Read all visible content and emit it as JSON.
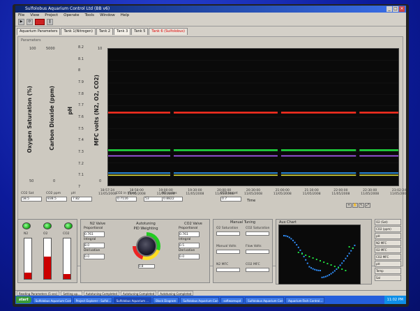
{
  "window": {
    "title": "Sulfolobus Aquarium Control Ltd (BB v6)"
  },
  "menu": [
    "File",
    "View",
    "Project",
    "Operate",
    "Tools",
    "Window",
    "Help"
  ],
  "tabs": [
    {
      "label": "Aquarium Parameters",
      "active": false,
      "alert": false
    },
    {
      "label": "Tank 1(Nitrogen)",
      "active": false,
      "alert": false
    },
    {
      "label": "Tank 2",
      "active": false,
      "alert": false
    },
    {
      "label": "Tank 3",
      "active": true,
      "alert": false
    },
    {
      "label": "Tank 5",
      "active": false,
      "alert": false
    },
    {
      "label": "Tank 6 (Sulfolobus)",
      "active": false,
      "alert": true
    }
  ],
  "panel": {
    "label": "Parameters"
  },
  "axes": {
    "oxygen": {
      "label": "Oxygen Saturation  (%)",
      "top": "100",
      "bottom": "50"
    },
    "co2": {
      "label": "Carbon Dioxide  (ppm)",
      "top": "5000",
      "bottom": "0"
    },
    "ph": {
      "label": "pH",
      "ticks": [
        "8.2",
        "8.1",
        "8",
        "7.9",
        "7.8",
        "7.7",
        "7.6",
        "7.5",
        "7.4",
        "7.3",
        "7.2",
        "7.1",
        "7"
      ]
    },
    "mfc": {
      "label": "MFC volts (N2, O2, CO2)",
      "top": "10",
      "bottom": "0"
    }
  },
  "chart_data": {
    "type": "line",
    "x": [
      0,
      1,
      2,
      3,
      4,
      5,
      6,
      7,
      8,
      9,
      10
    ],
    "x_ticks": [
      "18:57:24 11/05/2008",
      "18:58:00 11/05/2008",
      "19:00:00 11/05/2008",
      "19:30:00 11/05/2008",
      "20:00:00 11/05/2008",
      "20:30:00 11/05/2008",
      "21:00:00 11/05/2008",
      "21:30:00 11/05/2008",
      "22:00:00 11/05/2008",
      "22:30:00 11/05/2008",
      "23:02:24 11/05/2008"
    ],
    "xlabel": "Time",
    "ylim": [
      7,
      8.2
    ],
    "gaps": [
      2.2,
      5.9,
      8.6
    ],
    "series": [
      {
        "color": "#ff3020",
        "values": [
          7.64,
          7.64,
          7.64,
          7.64,
          7.64,
          7.64,
          7.64,
          7.64,
          7.64,
          7.64,
          7.64
        ]
      },
      {
        "color": "#20e040",
        "values": [
          7.31,
          7.31,
          7.31,
          7.31,
          7.31,
          7.31,
          7.31,
          7.31,
          7.31,
          7.31,
          7.31
        ]
      },
      {
        "color": "#b060ff",
        "values": [
          7.26,
          7.26,
          7.26,
          7.26,
          7.26,
          7.26,
          7.26,
          7.26,
          7.26,
          7.26,
          7.26
        ]
      },
      {
        "color": "#30a0ff",
        "values": [
          7.11,
          7.11,
          7.11,
          7.11,
          7.11,
          7.11,
          7.11,
          7.11,
          7.11,
          7.11,
          7.11
        ]
      },
      {
        "color": "#e0e040",
        "values": [
          7.09,
          7.09,
          7.09,
          7.09,
          7.09,
          7.09,
          7.09,
          7.09,
          7.09,
          7.09,
          7.09
        ]
      }
    ]
  },
  "fields": [
    {
      "label": "CO2 Sat",
      "value": "58.5"
    },
    {
      "label": "CO2 ppm",
      "value": "838.5"
    },
    {
      "label": "pH",
      "value": "7.82"
    },
    {
      "label": "CO2 in (flow)",
      "value": "0.7116"
    },
    {
      "label": "",
      "value": "53"
    },
    {
      "label": "N2 cycles",
      "value": "0.8822"
    },
    {
      "label": "CO2 target",
      "value": "0.7"
    }
  ],
  "bottom": {
    "leds": [
      {
        "label": "Blower"
      },
      {
        "label": "Air pump"
      },
      {
        "label": "Thermal pump"
      }
    ],
    "gauges": [
      {
        "label": "N2",
        "level": 0.15
      },
      {
        "label": "O2",
        "level": 0.55
      },
      {
        "label": "CO2",
        "level": 0.12
      }
    ],
    "pid_n2": {
      "title": "N2 Valve",
      "fields": [
        "Proportional",
        "0.761",
        "Integral",
        "8.0",
        "Derivative",
        "0.0"
      ]
    },
    "autotuning": {
      "title": "Autotuning",
      "sub": "PID Weighting",
      "value": "0.8"
    },
    "pid_co2": {
      "title": "CO2 Valve",
      "fields": [
        "Proportional",
        "0.761",
        "Integral",
        "0.5",
        "Derivative",
        "0.0"
      ]
    },
    "manual": {
      "title": "Manual Tuning",
      "rows": [
        "O2 Saturation",
        "CO2 Saturation",
        "Manual Volts",
        "Flow Volts",
        "N2 MFC",
        "CO2 MFC"
      ]
    },
    "mini_chart": {
      "title": "Aux Chart"
    },
    "legend": [
      "O2 (Sat)",
      "CO2 (ppm)",
      "pH",
      "N2 MFC",
      "O2 MFC",
      "CO2 MFC",
      "pH",
      "Temp",
      "Sal"
    ]
  },
  "statusbar": [
    "Reading Parameters (5 sec)",
    "Setting up...",
    "Autotuning Completed",
    "Autotuning Completed",
    "Autotuning Completed"
  ],
  "taskbar": {
    "start": "start",
    "tasks": [
      "Sulfolobus Aquarium Contr...",
      "Project Explorer - Sulfol...",
      "Sulfolobus Aquarium ...",
      "Block Diagram",
      "Sulfolobus Aquarium Cont...",
      "softwareupd",
      "Sulfolobus Aquarium Cont...",
      "Aquarium-Tech Control..."
    ],
    "clock": "11:02 PM"
  }
}
